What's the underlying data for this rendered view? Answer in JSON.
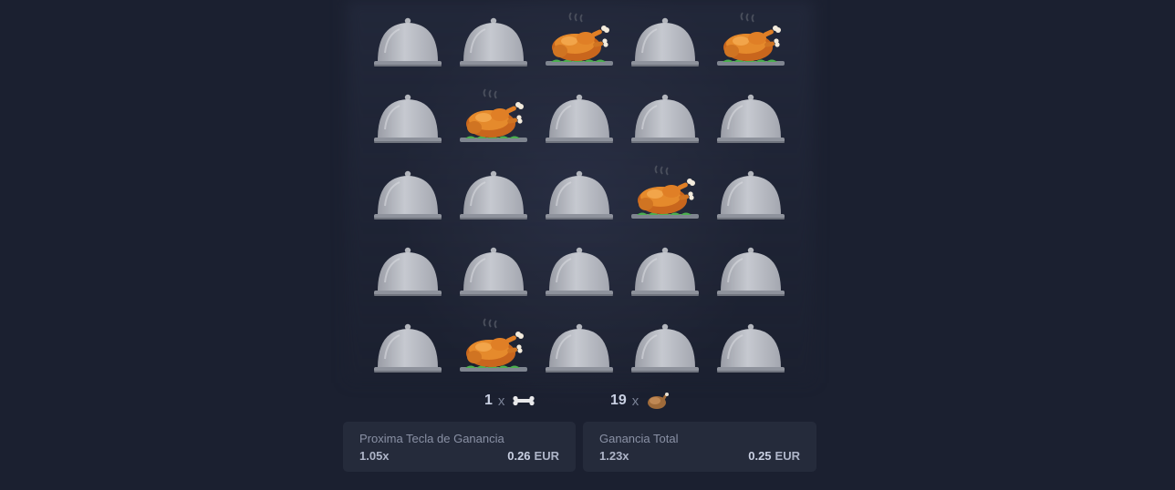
{
  "grid": {
    "rows": 5,
    "cols": 5,
    "cells": [
      "cloche",
      "cloche",
      "chicken",
      "cloche",
      "chicken",
      "cloche",
      "chicken",
      "cloche",
      "cloche",
      "cloche",
      "cloche",
      "cloche",
      "cloche",
      "chicken",
      "cloche",
      "cloche",
      "cloche",
      "cloche",
      "cloche",
      "cloche",
      "cloche",
      "chicken",
      "cloche",
      "cloche",
      "cloche"
    ]
  },
  "counters": {
    "bones": {
      "count": "1",
      "x": "x",
      "icon": "bone-icon"
    },
    "chickens": {
      "count": "19",
      "x": "x",
      "icon": "chicken-icon"
    }
  },
  "next_win": {
    "title": "Proxima Tecla de Ganancia",
    "multiplier": "1.05x",
    "amount": "0.26",
    "currency": "EUR"
  },
  "total_win": {
    "title": "Ganancia Total",
    "multiplier": "1.23x",
    "amount": "0.25",
    "currency": "EUR"
  },
  "colors": {
    "background": "#1b2030",
    "panel": "#252b3b",
    "cloche": "#b9bcc4",
    "chicken": "#e58a2c"
  }
}
